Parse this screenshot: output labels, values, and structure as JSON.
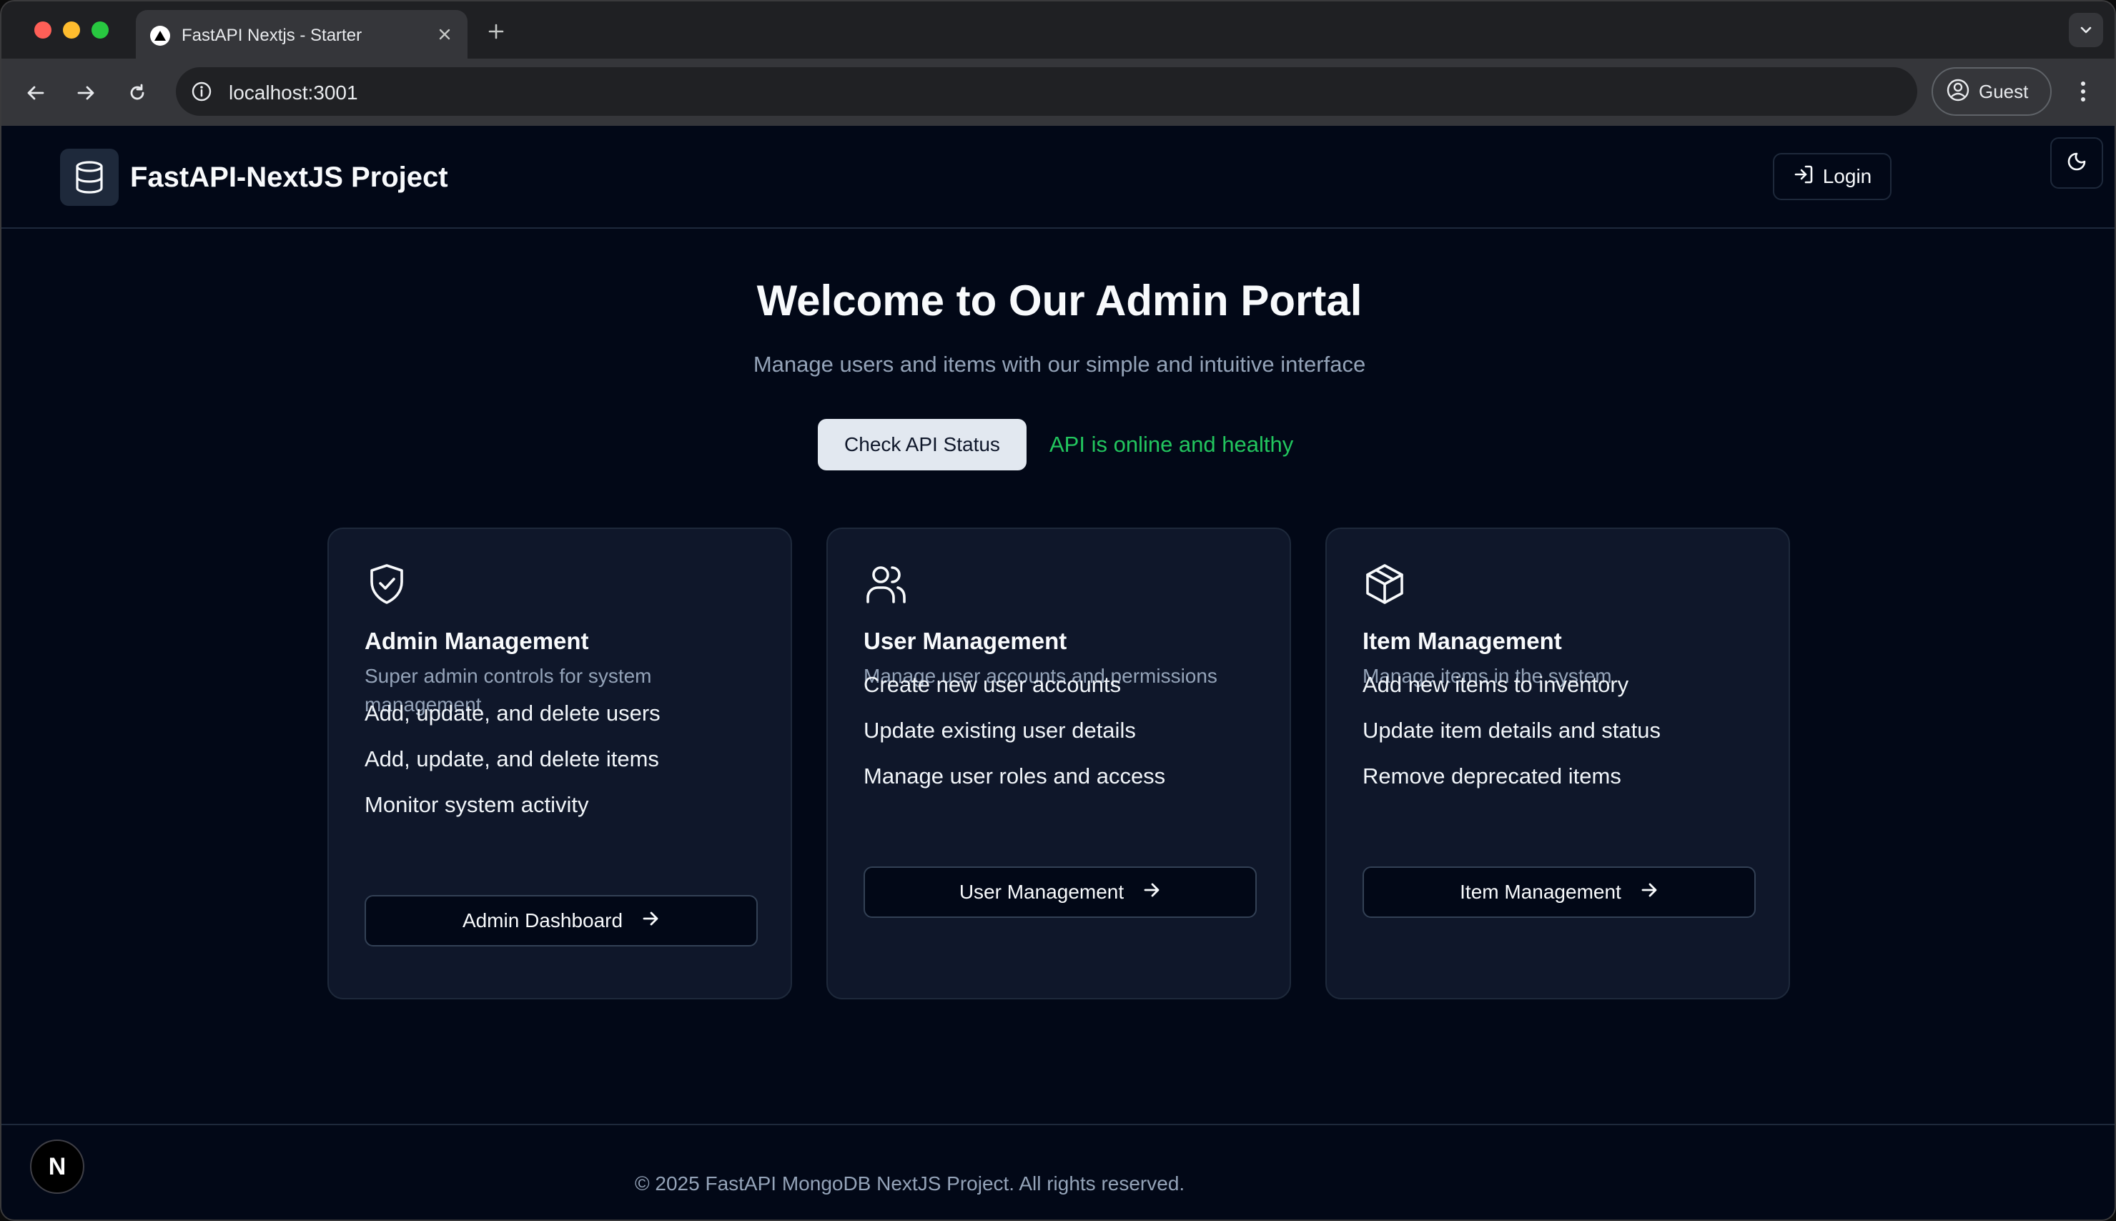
{
  "browser": {
    "tab_title": "FastAPI Nextjs - Starter",
    "url": "localhost:3001",
    "profile_label": "Guest"
  },
  "header": {
    "brand": "FastAPI-NextJS Project",
    "login_label": "Login"
  },
  "hero": {
    "title": "Welcome to Our Admin Portal",
    "subtitle": "Manage users and items with our simple and intuitive interface",
    "api_button": "Check API Status",
    "api_status": "API is online and healthy",
    "api_status_color": "#22c55e"
  },
  "cards": [
    {
      "icon": "shield-check-icon",
      "title": "Admin Management",
      "description": "Super admin controls for system management",
      "features": [
        "Add, update, and delete users",
        "Add, update, and delete items",
        "Monitor system activity"
      ],
      "button": "Admin Dashboard"
    },
    {
      "icon": "users-icon",
      "title": "User Management",
      "description": "Manage user accounts and permissions",
      "features": [
        "Create new user accounts",
        "Update existing user details",
        "Manage user roles and access"
      ],
      "button": "User Management"
    },
    {
      "icon": "package-icon",
      "title": "Item Management",
      "description": "Manage items in the system",
      "features": [
        "Add new items to inventory",
        "Update item details and status",
        "Remove deprecated items"
      ],
      "button": "Item Management"
    }
  ],
  "footer": {
    "text": "© 2025 FastAPI MongoDB NextJS Project. All rights reserved."
  },
  "dev_badge": "N"
}
